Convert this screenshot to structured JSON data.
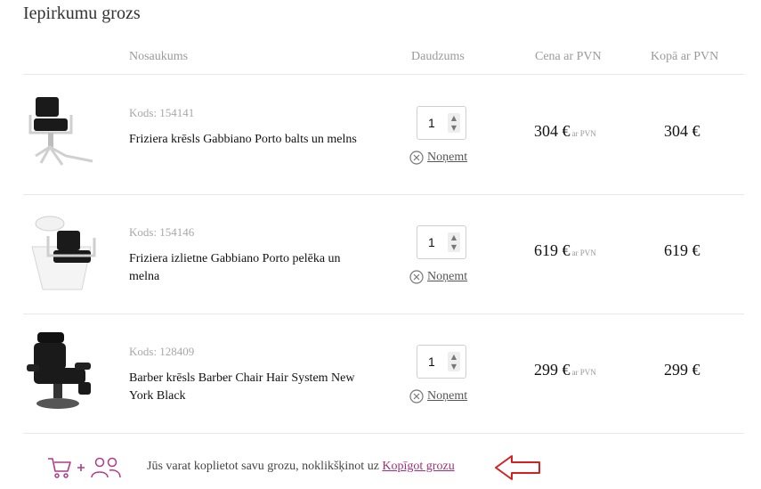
{
  "page": {
    "title": "Iepirkumu grozs"
  },
  "columns": {
    "name": "Nosaukums",
    "quantity": "Daudzums",
    "price_vat": "Cena ar PVN",
    "total_vat": "Kopā ar PVN"
  },
  "items": [
    {
      "code": "Kods: 154141",
      "name": "Friziera krēsls Gabbiano Porto balts un melns",
      "quantity": "1",
      "remove_label": "Noņemt",
      "price": "304 €",
      "price_suffix": "ar PVN",
      "total": "304 €",
      "image_icon": "salon-chair-white-base-icon"
    },
    {
      "code": "Kods: 154146",
      "name": "Friziera izlietne Gabbiano Porto pelēka un melna",
      "quantity": "1",
      "remove_label": "Noņemt",
      "price": "619 €",
      "price_suffix": "ar PVN",
      "total": "619 €",
      "image_icon": "backwash-unit-icon"
    },
    {
      "code": "Kods: 128409",
      "name": "Barber krēsls Barber Chair Hair System New York Black",
      "quantity": "1",
      "remove_label": "Noņemt",
      "price": "299 €",
      "price_suffix": "ar PVN",
      "total": "299 €",
      "image_icon": "barber-chair-icon"
    }
  ],
  "share": {
    "text": "Jūs varat koplietot savu grozu, noklikšķinot uz",
    "link_label": "Kopīgot grozu",
    "icons": [
      "cart-icon",
      "plus-icon",
      "users-icon"
    ],
    "accent_color": "#a12f7c",
    "arrow_color": "#d62020"
  }
}
